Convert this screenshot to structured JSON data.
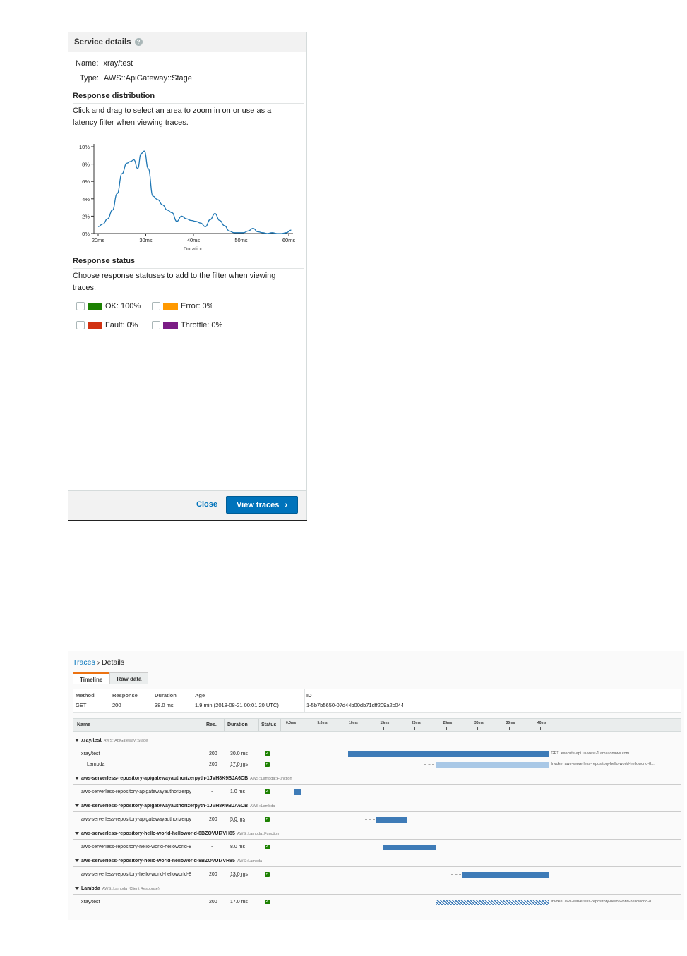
{
  "service_details": {
    "title": "Service details",
    "name_label": "Name:",
    "name_value": "xray/test",
    "type_label": "Type:",
    "type_value": "AWS::ApiGateway::Stage",
    "response_distribution": {
      "title": "Response distribution",
      "description": "Click and drag to select an area to zoom in on or use as a latency filter when viewing traces."
    },
    "response_status": {
      "title": "Response status",
      "description": "Choose response statuses to add to the filter when viewing traces.",
      "items": [
        {
          "label": "OK: 100%",
          "color": "#1d8102"
        },
        {
          "label": "Error: 0%",
          "color": "#ff9900"
        },
        {
          "label": "Fault: 0%",
          "color": "#d13212"
        },
        {
          "label": "Throttle: 0%",
          "color": "#7b1c85"
        }
      ]
    },
    "close_label": "Close",
    "view_traces_label": "View traces"
  },
  "chart_data": {
    "type": "line",
    "xlabel": "Duration",
    "ylabel": "",
    "x_ticks": [
      "20ms",
      "30ms",
      "40ms",
      "50ms",
      "60ms"
    ],
    "y_ticks": [
      "0%",
      "2%",
      "4%",
      "6%",
      "8%",
      "10%"
    ],
    "xlim": [
      20,
      60
    ],
    "ylim": [
      0,
      10
    ],
    "grid": false,
    "color": "#1f77b4",
    "series": [
      {
        "x": [
          20,
          21,
          22,
          23,
          24,
          25,
          26,
          26.8,
          27.5,
          28.3,
          29,
          29.7,
          30.5,
          31.5,
          32.5,
          33.5,
          34.5,
          35.5,
          36.5,
          37.5,
          38.5,
          39.5,
          40.5,
          41.5,
          42.5,
          43.5,
          44.5,
          45.5,
          46.5,
          47.5,
          48.5,
          49.5,
          50.5,
          51.5,
          52.5,
          53.5,
          54.5,
          55.5,
          56.5,
          57.5,
          58.5,
          59.5,
          60.5
        ],
        "y": [
          0.8,
          1.1,
          1.7,
          2.7,
          4.6,
          6.9,
          8.1,
          8.3,
          8.5,
          7.5,
          9.2,
          9.5,
          7.5,
          4.3,
          3.9,
          3.3,
          2.7,
          2.4,
          1.4,
          2.0,
          1.7,
          1.5,
          1.4,
          1.2,
          0.8,
          1.6,
          2.3,
          1.5,
          0.9,
          0.3,
          0.1,
          0.1,
          0.1,
          0.3,
          0.6,
          0.2,
          0.1,
          0.0,
          0.1,
          0.0,
          0.0,
          0.1,
          0.4
        ]
      }
    ]
  },
  "trace": {
    "breadcrumb_link": "Traces",
    "breadcrumb_sep": "›",
    "breadcrumb_current": "Details",
    "tabs": [
      "Timeline",
      "Raw data"
    ],
    "meta": {
      "method_h": "Method",
      "method_v": "GET",
      "response_h": "Response",
      "response_v": "200",
      "duration_h": "Duration",
      "duration_v": "38.0 ms",
      "age_h": "Age",
      "age_v": "1.9 min (2018-08-21 00:01:20 UTC)",
      "id_h": "ID",
      "id_v": "1-5b7b5650-07d44b00db71dff209a2c044"
    },
    "columns": {
      "name": "Name",
      "res": "Res.",
      "duration": "Duration",
      "status": "Status"
    },
    "timeline_ticks": [
      "0.0ms",
      "5.0ms",
      "10ms",
      "15ms",
      "20ms",
      "25ms",
      "30ms",
      "35ms",
      "40ms"
    ],
    "groups": [
      {
        "name": "xray/test",
        "type": "AWS::ApiGateway::Stage",
        "rows": [
          {
            "name": "xray/test",
            "res": "200",
            "duration": "30.0 ms",
            "start": 9.5,
            "end": 41.5,
            "style": "solid",
            "label": "GET                         .execute-api.us-west-1.amazonaws.com..."
          },
          {
            "name": "Lambda",
            "res": "200",
            "duration": "17.0 ms",
            "start": 23.5,
            "end": 41.5,
            "style": "light",
            "label": "Invoke: aws-serverless-repository-hello-world-helloworld-8..."
          }
        ]
      },
      {
        "name": "aws-serverless-repository-apigatewayauthorizerpyth-1JVH8K9BJA6CB",
        "type": "AWS::Lambda::Function",
        "rows": [
          {
            "name": "aws-serverless-repository-apigatewayauthorizerpy",
            "res": "-",
            "duration": "1.0 ms",
            "start": 1.0,
            "end": 2.0,
            "style": "solid",
            "label": ""
          }
        ]
      },
      {
        "name": "aws-serverless-repository-apigatewayauthorizerpyth-1JVH8K9BJA6CB",
        "type": "AWS::Lambda",
        "rows": [
          {
            "name": "aws-serverless-repository-apigatewayauthorizerpy",
            "res": "200",
            "duration": "5.0 ms",
            "start": 14.0,
            "end": 19.0,
            "style": "solid",
            "label": ""
          }
        ]
      },
      {
        "name": "aws-serverless-repository-hello-world-helloworld-8BZOVUI7VH85",
        "type": "AWS::Lambda::Function",
        "rows": [
          {
            "name": "aws-serverless-repository-hello-world-helloworld-8",
            "res": "-",
            "duration": "8.0 ms",
            "start": 15.0,
            "end": 23.5,
            "style": "solid",
            "label": ""
          }
        ]
      },
      {
        "name": "aws-serverless-repository-hello-world-helloworld-8BZOVUI7VH85",
        "type": "AWS::Lambda",
        "rows": [
          {
            "name": "aws-serverless-repository-hello-world-helloworld-8",
            "res": "200",
            "duration": "13.0 ms",
            "start": 27.7,
            "end": 41.5,
            "style": "solid",
            "label": ""
          }
        ]
      },
      {
        "name": "Lambda",
        "type": "AWS::Lambda (Client Response)",
        "rows": [
          {
            "name": "xray/test",
            "res": "200",
            "duration": "17.0 ms",
            "start": 23.5,
            "end": 41.5,
            "style": "hatched",
            "label": "Invoke: aws-serverless-repository-hello-world-helloworld-8..."
          }
        ]
      }
    ]
  }
}
